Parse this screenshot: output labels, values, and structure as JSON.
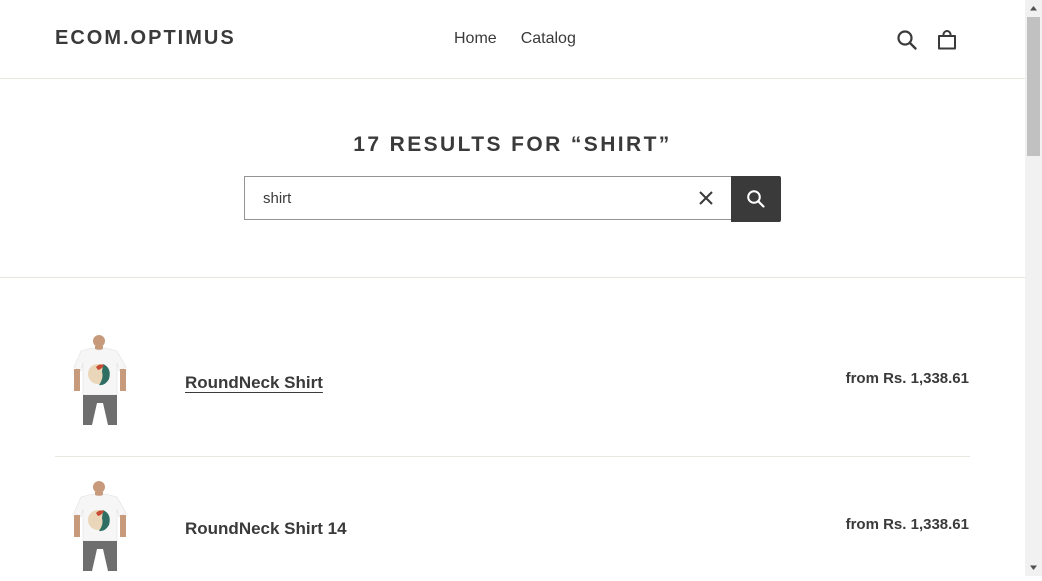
{
  "header": {
    "logo": "ECOM.OPTIMUS",
    "nav": [
      {
        "label": "Home"
      },
      {
        "label": "Catalog"
      }
    ],
    "icons": [
      "search-icon",
      "cart-icon"
    ]
  },
  "search": {
    "title": "17 RESULTS FOR “SHIRT”",
    "query": "shirt",
    "clear_icon": "close-icon",
    "submit_icon": "search-icon"
  },
  "results": [
    {
      "title": "RoundNeck Shirt",
      "price": "from Rs. 1,338.61"
    },
    {
      "title": "RoundNeck Shirt 14",
      "price": "from Rs. 1,338.61"
    }
  ],
  "colors": {
    "text": "#3a3a3a",
    "border": "#e8e8e1",
    "button_bg": "#3a3a3a",
    "scrollbar_track": "#f1f1f1",
    "scrollbar_thumb": "#c1c1c1"
  }
}
